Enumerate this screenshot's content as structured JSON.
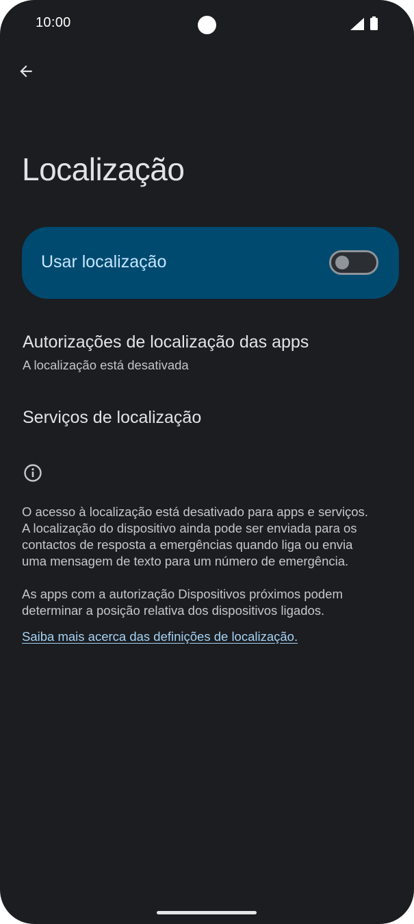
{
  "status_bar": {
    "time": "10:00",
    "signal_icon": "cell-signal-icon",
    "battery_icon": "battery-icon"
  },
  "toolbar": {
    "back_icon": "arrow-back-icon"
  },
  "page": {
    "title": "Localização"
  },
  "main_toggle": {
    "label": "Usar localização",
    "checked": false
  },
  "items": [
    {
      "title": "Autorizações de localização das apps",
      "summary": "A localização está desativada"
    },
    {
      "title": "Serviços de localização"
    }
  ],
  "footer": {
    "info_icon": "info-icon",
    "paragraph1_lines": [
      "O acesso à localização está desativado para apps e serviços.",
      "A localização do dispositivo ainda pode ser enviada para os",
      "contactos de resposta a emergências quando liga ou envia",
      "uma mensagem de texto para um número de emergência."
    ],
    "paragraph2_lines": [
      "As apps com a autorização Dispositivos próximos podem",
      "determinar a posição relativa dos dispositivos ligados."
    ],
    "link": "Saiba mais acerca das definições de localização."
  },
  "colors": {
    "background": "#1b1d20",
    "card": "#004a70",
    "card_text": "#c5e7ff",
    "link": "#a6d2f4"
  }
}
